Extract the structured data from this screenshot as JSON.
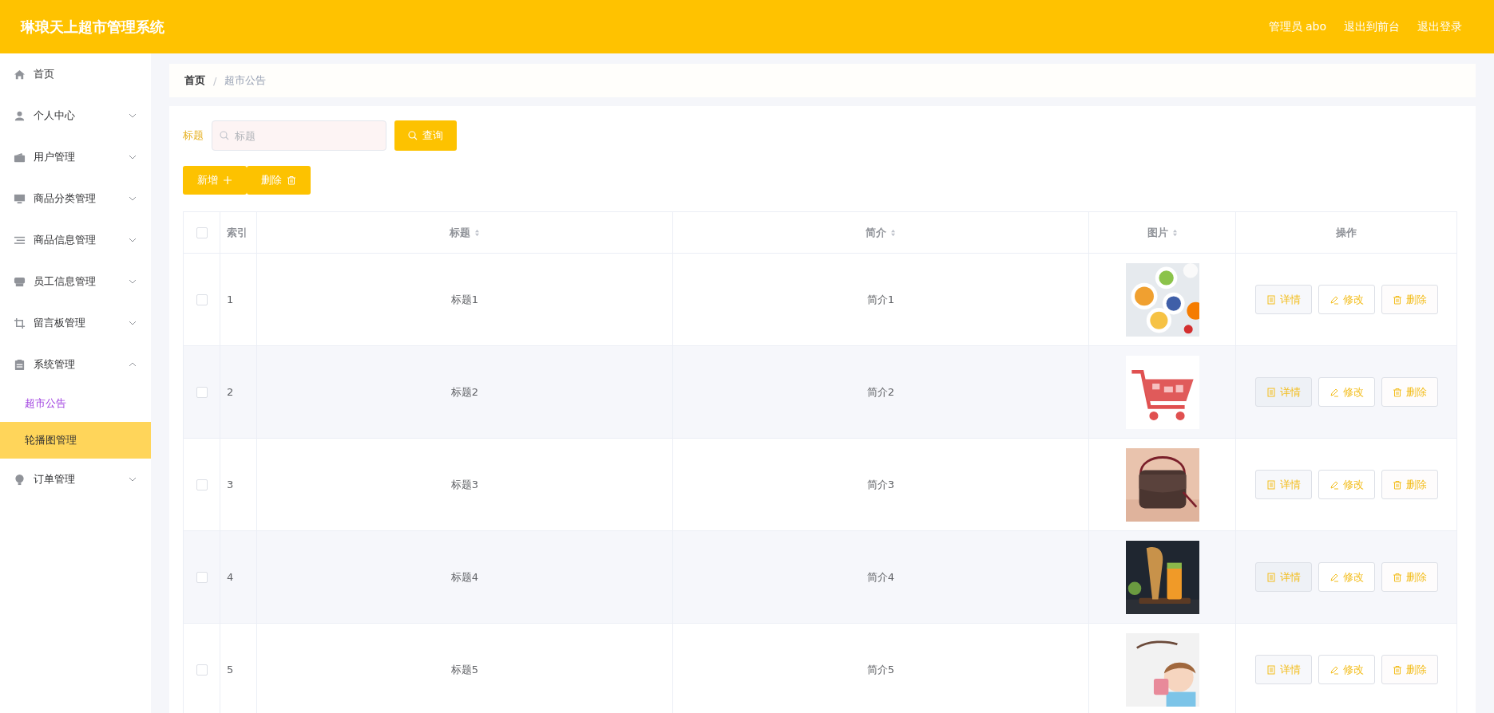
{
  "header": {
    "title": "琳琅天上超市管理系统",
    "links": [
      "管理员 abo",
      "退出到前台",
      "退出登录"
    ]
  },
  "sidebar": {
    "items": [
      {
        "label": "首页",
        "kind": "link"
      },
      {
        "label": "个人中心",
        "kind": "submenu",
        "expanded": false
      },
      {
        "label": "用户管理",
        "kind": "submenu",
        "expanded": false
      },
      {
        "label": "商品分类管理",
        "kind": "submenu",
        "expanded": false
      },
      {
        "label": "商品信息管理",
        "kind": "submenu",
        "expanded": false
      },
      {
        "label": "员工信息管理",
        "kind": "submenu",
        "expanded": false
      },
      {
        "label": "留言板管理",
        "kind": "submenu",
        "expanded": false
      },
      {
        "label": "系统管理",
        "kind": "submenu",
        "expanded": true,
        "children": [
          {
            "label": "超市公告",
            "selected": true,
            "highlighted": false
          },
          {
            "label": "轮播图管理",
            "selected": false,
            "highlighted": true
          }
        ]
      },
      {
        "label": "订单管理",
        "kind": "submenu",
        "expanded": false
      }
    ]
  },
  "breadcrumb": {
    "separator": "/",
    "items": [
      {
        "label": "首页",
        "current": false
      },
      {
        "label": "超市公告",
        "current": true
      }
    ]
  },
  "search": {
    "label": "标题",
    "placeholder": "标题",
    "button": "查询"
  },
  "toolbar": [
    {
      "label": "新增",
      "kind": "add"
    },
    {
      "label": "删除",
      "kind": "delete"
    }
  ],
  "table": {
    "select_all": {
      "checked": false
    },
    "columns": [
      {
        "label": "索引",
        "sortable": false
      },
      {
        "label": "标题",
        "sortable": true
      },
      {
        "label": "简介",
        "sortable": true
      },
      {
        "label": "图片",
        "sortable": true
      },
      {
        "label": "操作",
        "sortable": false
      }
    ],
    "rows": [
      {
        "checked": false,
        "index": "1",
        "title": "标题1",
        "intro": "简介1",
        "actions": [
          {
            "label": "详情",
            "kind": "detail"
          },
          {
            "label": "修改",
            "kind": "edit"
          },
          {
            "label": "删除",
            "kind": "delete"
          }
        ]
      },
      {
        "checked": false,
        "index": "2",
        "title": "标题2",
        "intro": "简介2",
        "actions": [
          {
            "label": "详情",
            "kind": "detail"
          },
          {
            "label": "修改",
            "kind": "edit"
          },
          {
            "label": "删除",
            "kind": "delete"
          }
        ]
      },
      {
        "checked": false,
        "index": "3",
        "title": "标题3",
        "intro": "简介3",
        "actions": [
          {
            "label": "详情",
            "kind": "detail"
          },
          {
            "label": "修改",
            "kind": "edit"
          },
          {
            "label": "删除",
            "kind": "delete"
          }
        ]
      },
      {
        "checked": false,
        "index": "4",
        "title": "标题4",
        "intro": "简介4",
        "actions": [
          {
            "label": "详情",
            "kind": "detail"
          },
          {
            "label": "修改",
            "kind": "edit"
          },
          {
            "label": "删除",
            "kind": "delete"
          }
        ]
      },
      {
        "checked": false,
        "index": "5",
        "title": "标题5",
        "intro": "简介5",
        "actions": [
          {
            "label": "详情",
            "kind": "detail"
          },
          {
            "label": "修改",
            "kind": "edit"
          },
          {
            "label": "删除",
            "kind": "delete"
          }
        ]
      }
    ]
  }
}
